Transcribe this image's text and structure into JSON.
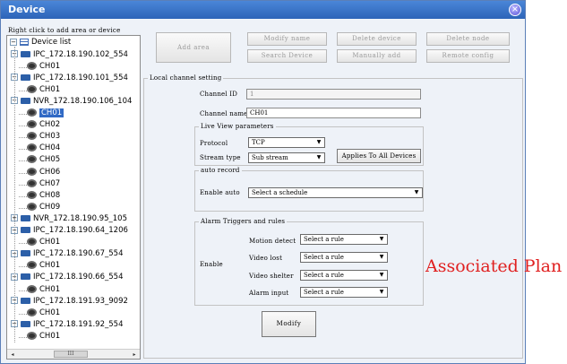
{
  "window": {
    "title": "Device",
    "close_glyph": "×"
  },
  "tree": {
    "hint": "Right click to add area or device",
    "root": "Device list",
    "nodes": [
      {
        "label": "IPC_172.18.190.102_554",
        "level": 1,
        "kind": "device",
        "expanded": true
      },
      {
        "label": "CH01",
        "level": 2,
        "kind": "channel"
      },
      {
        "label": "IPC_172.18.190.101_554",
        "level": 1,
        "kind": "device",
        "expanded": true
      },
      {
        "label": "CH01",
        "level": 2,
        "kind": "channel"
      },
      {
        "label": "NVR_172.18.190.106_104",
        "level": 1,
        "kind": "device",
        "expanded": true
      },
      {
        "label": "CH01",
        "level": 2,
        "kind": "channel",
        "selected": true
      },
      {
        "label": "CH02",
        "level": 2,
        "kind": "channel"
      },
      {
        "label": "CH03",
        "level": 2,
        "kind": "channel"
      },
      {
        "label": "CH04",
        "level": 2,
        "kind": "channel"
      },
      {
        "label": "CH05",
        "level": 2,
        "kind": "channel"
      },
      {
        "label": "CH06",
        "level": 2,
        "kind": "channel"
      },
      {
        "label": "CH07",
        "level": 2,
        "kind": "channel"
      },
      {
        "label": "CH08",
        "level": 2,
        "kind": "channel"
      },
      {
        "label": "CH09",
        "level": 2,
        "kind": "channel"
      },
      {
        "label": "NVR_172.18.190.95_105",
        "level": 1,
        "kind": "device",
        "expanded": false
      },
      {
        "label": "IPC_172.18.190.64_1206",
        "level": 1,
        "kind": "device",
        "expanded": true
      },
      {
        "label": "CH01",
        "level": 2,
        "kind": "channel"
      },
      {
        "label": "IPC_172.18.190.67_554",
        "level": 1,
        "kind": "device",
        "expanded": true
      },
      {
        "label": "CH01",
        "level": 2,
        "kind": "channel"
      },
      {
        "label": "IPC_172.18.190.66_554",
        "level": 1,
        "kind": "device",
        "expanded": true
      },
      {
        "label": "CH01",
        "level": 2,
        "kind": "channel"
      },
      {
        "label": "IPC_172.18.191.93_9092",
        "level": 1,
        "kind": "device",
        "expanded": true
      },
      {
        "label": "CH01",
        "level": 2,
        "kind": "channel"
      },
      {
        "label": "IPC_172.18.191.92_554",
        "level": 1,
        "kind": "device",
        "expanded": true
      },
      {
        "label": "CH01",
        "level": 2,
        "kind": "channel"
      }
    ],
    "scroll_left": "◂",
    "scroll_right": "▸",
    "scroll_thumb": "III"
  },
  "toolbar": {
    "add_area": "Add area",
    "modify_name": "Modify name",
    "delete_device": "Delete device",
    "delete_node": "Delete node",
    "search_device": "Search Device",
    "manually_add": "Manually add",
    "remote_config": "Remote config"
  },
  "channel": {
    "legend": "Local channel setting",
    "id_label": "Channel ID",
    "id_value": "1",
    "name_label": "Channel name",
    "name_value": "CH01"
  },
  "live_view": {
    "legend": "Live View parameters",
    "protocol_label": "Protocol",
    "protocol_value": "TCP",
    "stream_label": "Stream type",
    "stream_value": "Sub stream",
    "apply_all": "Applies To All Devices"
  },
  "auto_record": {
    "legend": "auto record",
    "enable_label": "Enable auto",
    "schedule_value": "Select a schedule"
  },
  "alarm": {
    "legend": "Alarm Triggers and rules",
    "enable_label": "Enable",
    "motion_label": "Motion detect",
    "motion_value": "Select a rule",
    "video_lost_label": "Video lost",
    "video_lost_value": "Select a rule",
    "video_shelter_label": "Video shelter",
    "video_shelter_value": "Select a rule",
    "alarm_input_label": "Alarm input",
    "alarm_input_value": "Select a rule"
  },
  "actions": {
    "modify": "Modify"
  },
  "annotation": {
    "text": "Associated Plan",
    "color": "#e02020"
  },
  "dropdown_glyph": "▼"
}
